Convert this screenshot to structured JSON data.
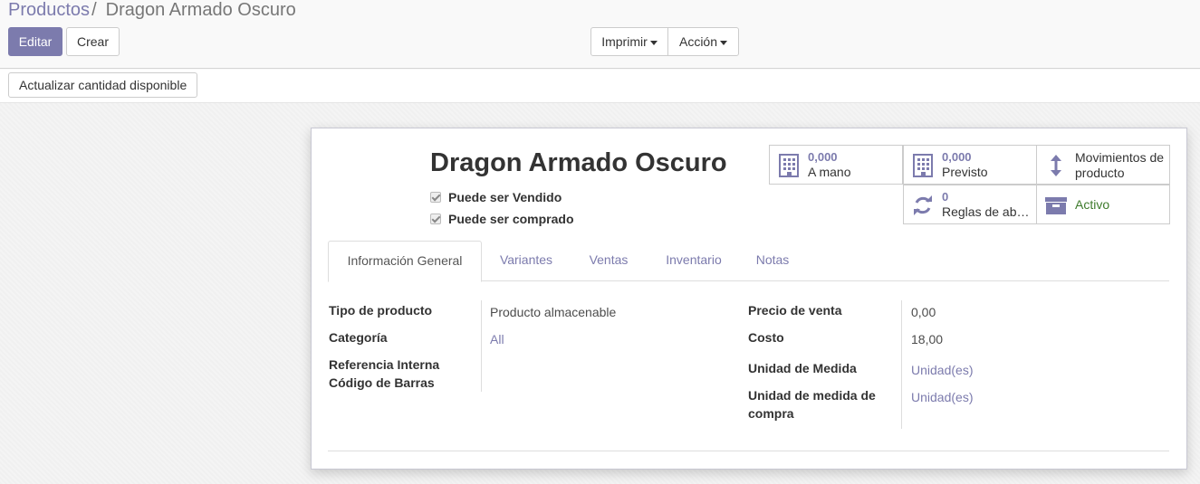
{
  "breadcrumb": {
    "parent": "Productos",
    "separator": "/",
    "current": "Dragon Armado Oscuro"
  },
  "buttons": {
    "edit": "Editar",
    "create": "Crear",
    "print": "Imprimir",
    "action": "Acción",
    "update_qty": "Actualizar cantidad disponible"
  },
  "product": {
    "name": "Dragon Armado Oscuro",
    "can_be_sold": "Puede ser Vendido",
    "can_be_purchased": "Puede ser comprado"
  },
  "smart_buttons": {
    "on_hand": {
      "value": "0,000",
      "label": "A mano",
      "icon": "building-icon"
    },
    "forecast": {
      "value": "0,000",
      "label": "Previsto",
      "icon": "building-icon"
    },
    "moves": {
      "label_line1": "Movimientos de",
      "label_line2": "producto",
      "icon": "vertical-arrows-icon"
    },
    "reorder": {
      "value": "0",
      "label": "Reglas de ab…",
      "icon": "refresh-icon"
    },
    "active": {
      "label": "Activo",
      "icon": "archive-box-icon"
    }
  },
  "tabs": [
    {
      "label": "Información General",
      "active": true
    },
    {
      "label": "Variantes"
    },
    {
      "label": "Ventas"
    },
    {
      "label": "Inventario"
    },
    {
      "label": "Notas"
    }
  ],
  "fields_left": {
    "product_type": {
      "label": "Tipo de producto",
      "value": "Producto almacenable"
    },
    "category": {
      "label": "Categoría",
      "value": "All"
    },
    "internal_ref": {
      "label": "Referencia Interna",
      "value": ""
    },
    "barcode": {
      "label": "Código de Barras",
      "value": ""
    }
  },
  "fields_right": {
    "sale_price": {
      "label": "Precio de venta",
      "value": "0,00"
    },
    "cost": {
      "label": "Costo",
      "value": "18,00"
    },
    "uom": {
      "label": "Unidad de Medida",
      "value": "Unidad(es)"
    },
    "purchase_uom": {
      "label_line1": "Unidad de medida de",
      "label_line2": "compra",
      "value": "Unidad(es)"
    }
  },
  "colors": {
    "accent": "#7c7bad",
    "active_green": "#3e7b2c"
  }
}
